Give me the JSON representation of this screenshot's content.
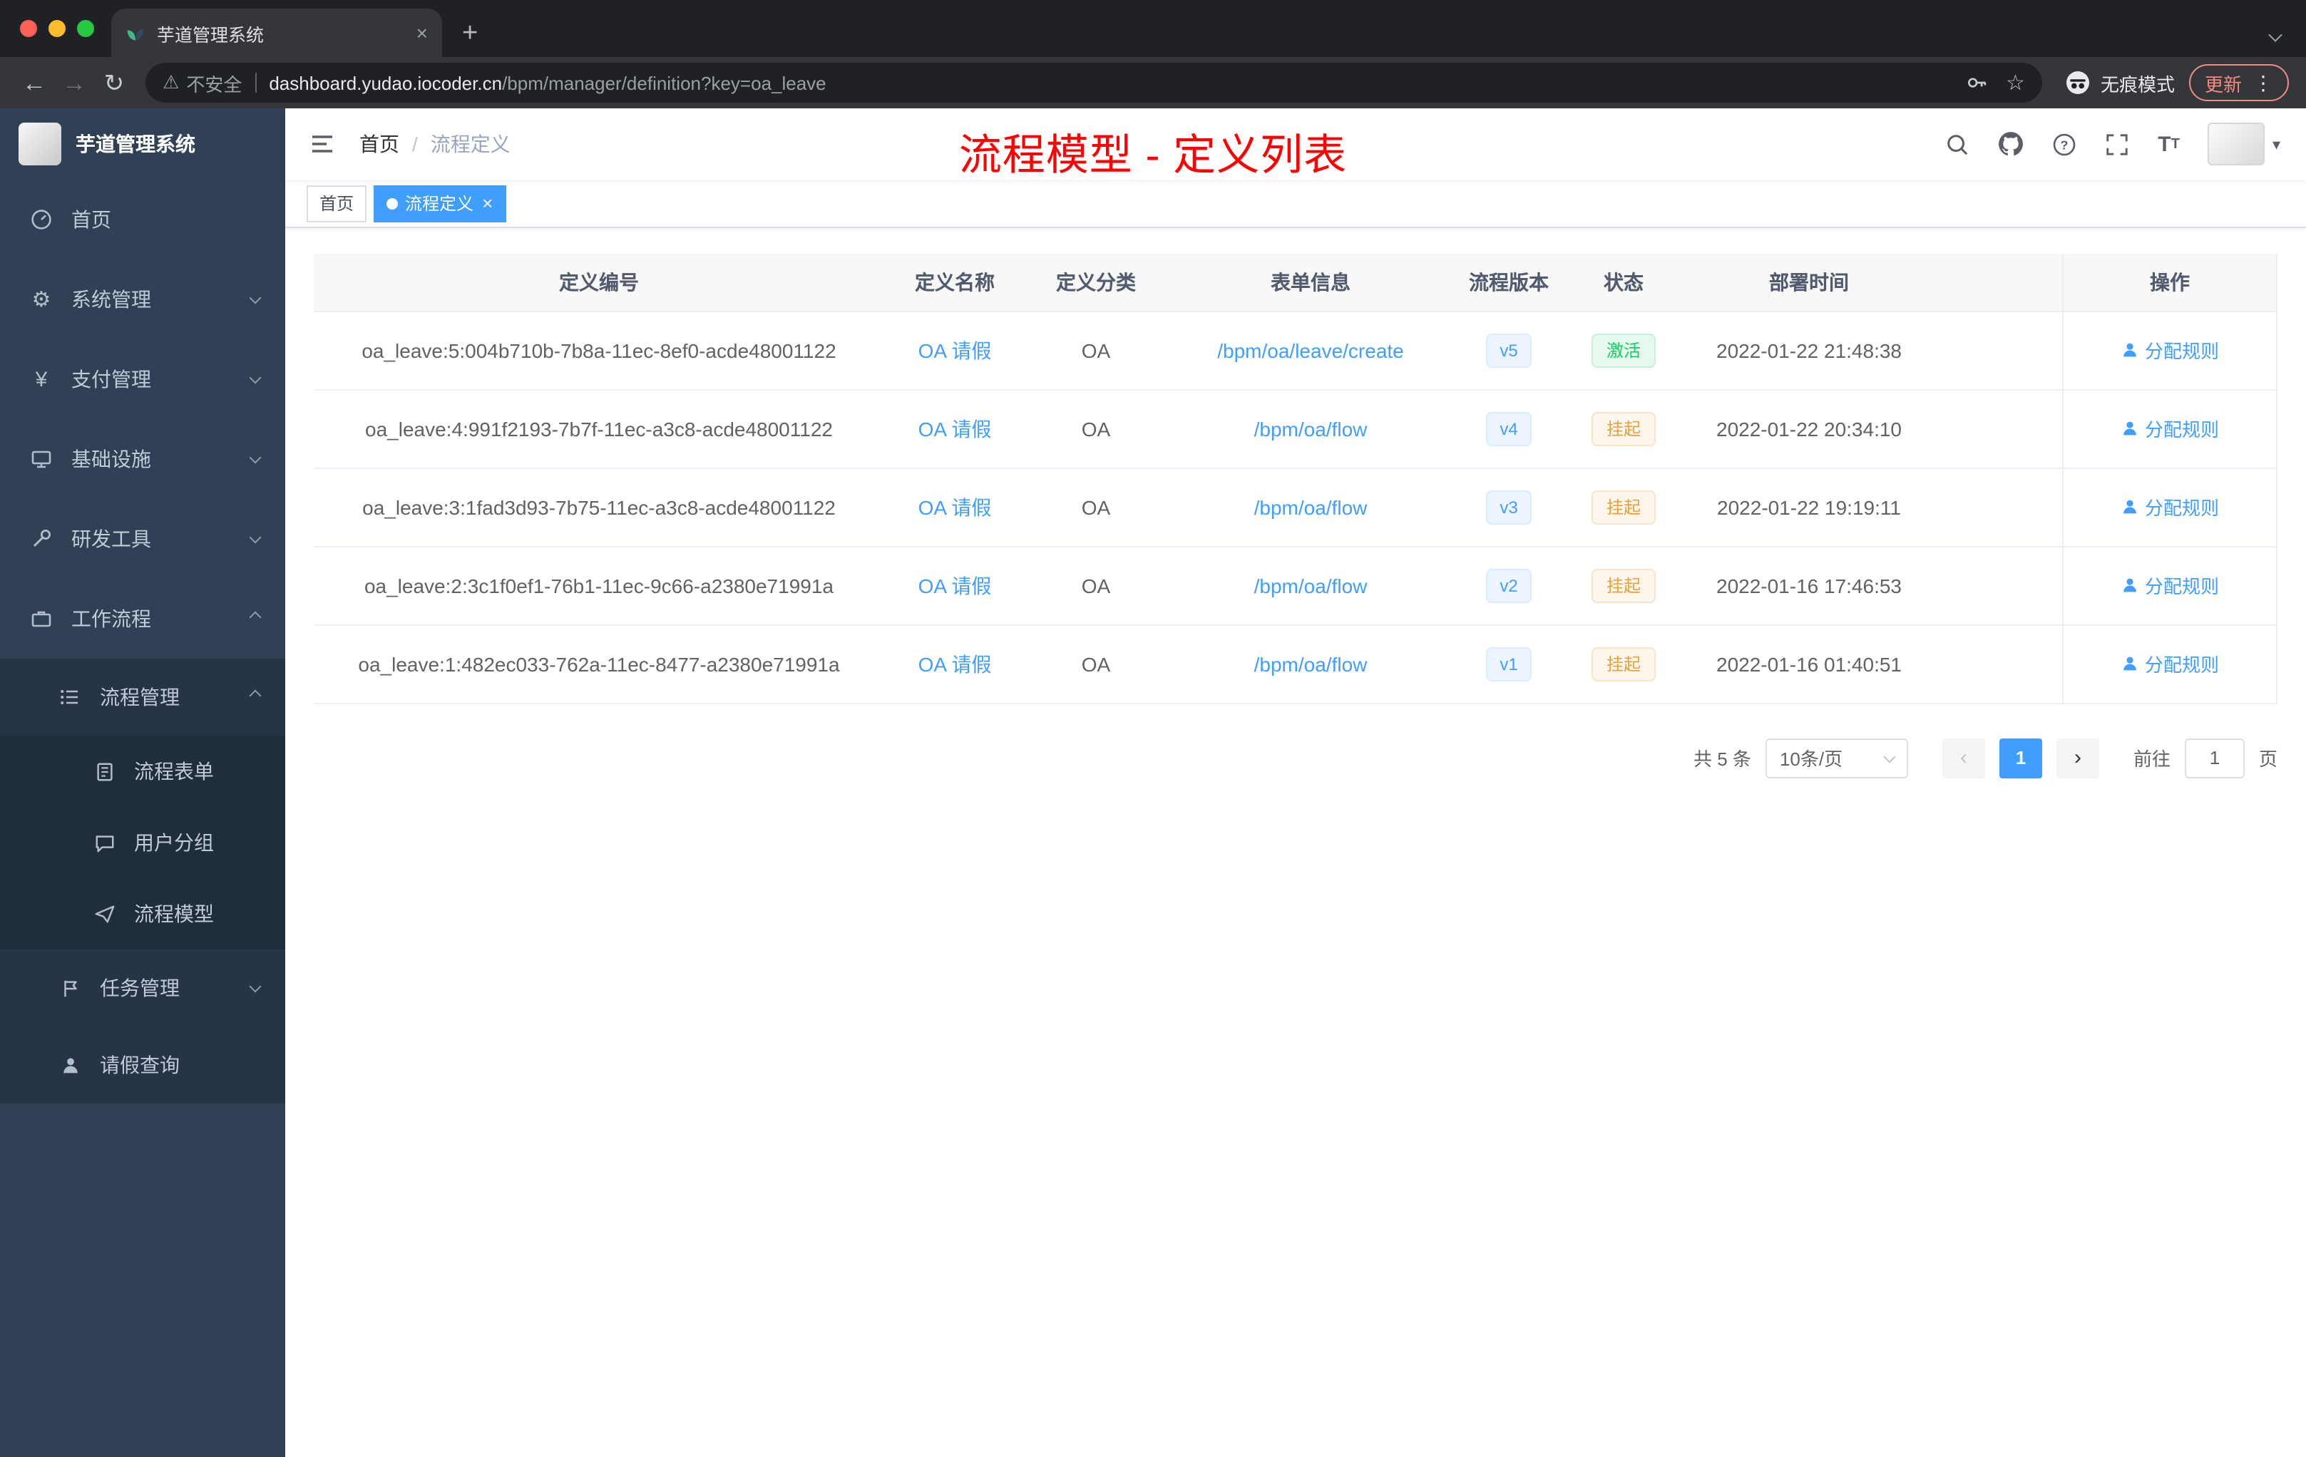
{
  "colors": {
    "accent_blue": "#409eff",
    "success_green": "#13ce66",
    "warning_orange": "#e6a23c",
    "annotation_red": "#fe0100",
    "sidebar_bg": "#304156"
  },
  "icons": {
    "close": "×",
    "plus": "+",
    "back": "←",
    "forward": "→",
    "reload": "↻",
    "warning": "⚠",
    "star": "☆",
    "dots": "⋮",
    "caret": "▾",
    "prev": "‹",
    "next": "›",
    "gear": "⚙",
    "yen": "¥"
  },
  "browser": {
    "tab_title": "芋道管理系统",
    "security_label": "不安全",
    "url_host": "dashboard.yudao.iocoder.cn",
    "url_path": "/bpm/manager/definition?key=oa_leave",
    "incognito_label": "无痕模式",
    "update_label": "更新"
  },
  "sidebar": {
    "logo_title": "芋道管理系统",
    "items": [
      {
        "label": "首页",
        "icon": "dashboard-icon"
      },
      {
        "label": "系统管理",
        "icon": "gear-icon"
      },
      {
        "label": "支付管理",
        "icon": "yen-icon"
      },
      {
        "label": "基础设施",
        "icon": "infrastructure-icon"
      },
      {
        "label": "研发工具",
        "icon": "tools-icon"
      },
      {
        "label": "工作流程",
        "icon": "workflow-icon"
      },
      {
        "label": "流程管理",
        "icon": "process-list-icon"
      },
      {
        "label": "流程表单",
        "icon": "form-icon"
      },
      {
        "label": "用户分组",
        "icon": "user-group-icon"
      },
      {
        "label": "流程模型",
        "icon": "paper-plane-icon"
      },
      {
        "label": "任务管理",
        "icon": "task-icon"
      },
      {
        "label": "请假查询",
        "icon": "person-icon"
      }
    ]
  },
  "navbar": {
    "breadcrumb": {
      "home": "首页",
      "separator": "/",
      "current": "流程定义"
    }
  },
  "annotation": {
    "text": "流程模型 - 定义列表"
  },
  "tags_view": {
    "tags": [
      {
        "label": "首页",
        "active": false
      },
      {
        "label": "流程定义",
        "active": true
      }
    ]
  },
  "table": {
    "columns": [
      "定义编号",
      "定义名称",
      "定义分类",
      "表单信息",
      "流程版本",
      "状态",
      "部署时间",
      "操作"
    ],
    "rows": [
      {
        "id": "oa_leave:5:004b710b-7b8a-11ec-8ef0-acde48001122",
        "name": "OA 请假",
        "category": "OA",
        "form": "/bpm/oa/leave/create",
        "version": "v5",
        "status": "激活",
        "deploy_time": "2022-01-22 21:48:38",
        "action": "分配规则"
      },
      {
        "id": "oa_leave:4:991f2193-7b7f-11ec-a3c8-acde48001122",
        "name": "OA 请假",
        "category": "OA",
        "form": "/bpm/oa/flow",
        "version": "v4",
        "status": "挂起",
        "deploy_time": "2022-01-22 20:34:10",
        "action": "分配规则"
      },
      {
        "id": "oa_leave:3:1fad3d93-7b75-11ec-a3c8-acde48001122",
        "name": "OA 请假",
        "category": "OA",
        "form": "/bpm/oa/flow",
        "version": "v3",
        "status": "挂起",
        "deploy_time": "2022-01-22 19:19:11",
        "action": "分配规则"
      },
      {
        "id": "oa_leave:2:3c1f0ef1-76b1-11ec-9c66-a2380e71991a",
        "name": "OA 请假",
        "category": "OA",
        "form": "/bpm/oa/flow",
        "version": "v2",
        "status": "挂起",
        "deploy_time": "2022-01-16 17:46:53",
        "action": "分配规则"
      },
      {
        "id": "oa_leave:1:482ec033-762a-11ec-8477-a2380e71991a",
        "name": "OA 请假",
        "category": "OA",
        "form": "/bpm/oa/flow",
        "version": "v1",
        "status": "挂起",
        "deploy_time": "2022-01-16 01:40:51",
        "action": "分配规则"
      }
    ]
  },
  "pagination": {
    "total": "共 5 条",
    "page_size": "10条/页",
    "current_page": "1",
    "goto_label": "前往",
    "goto_value": "1",
    "page_unit": "页"
  }
}
